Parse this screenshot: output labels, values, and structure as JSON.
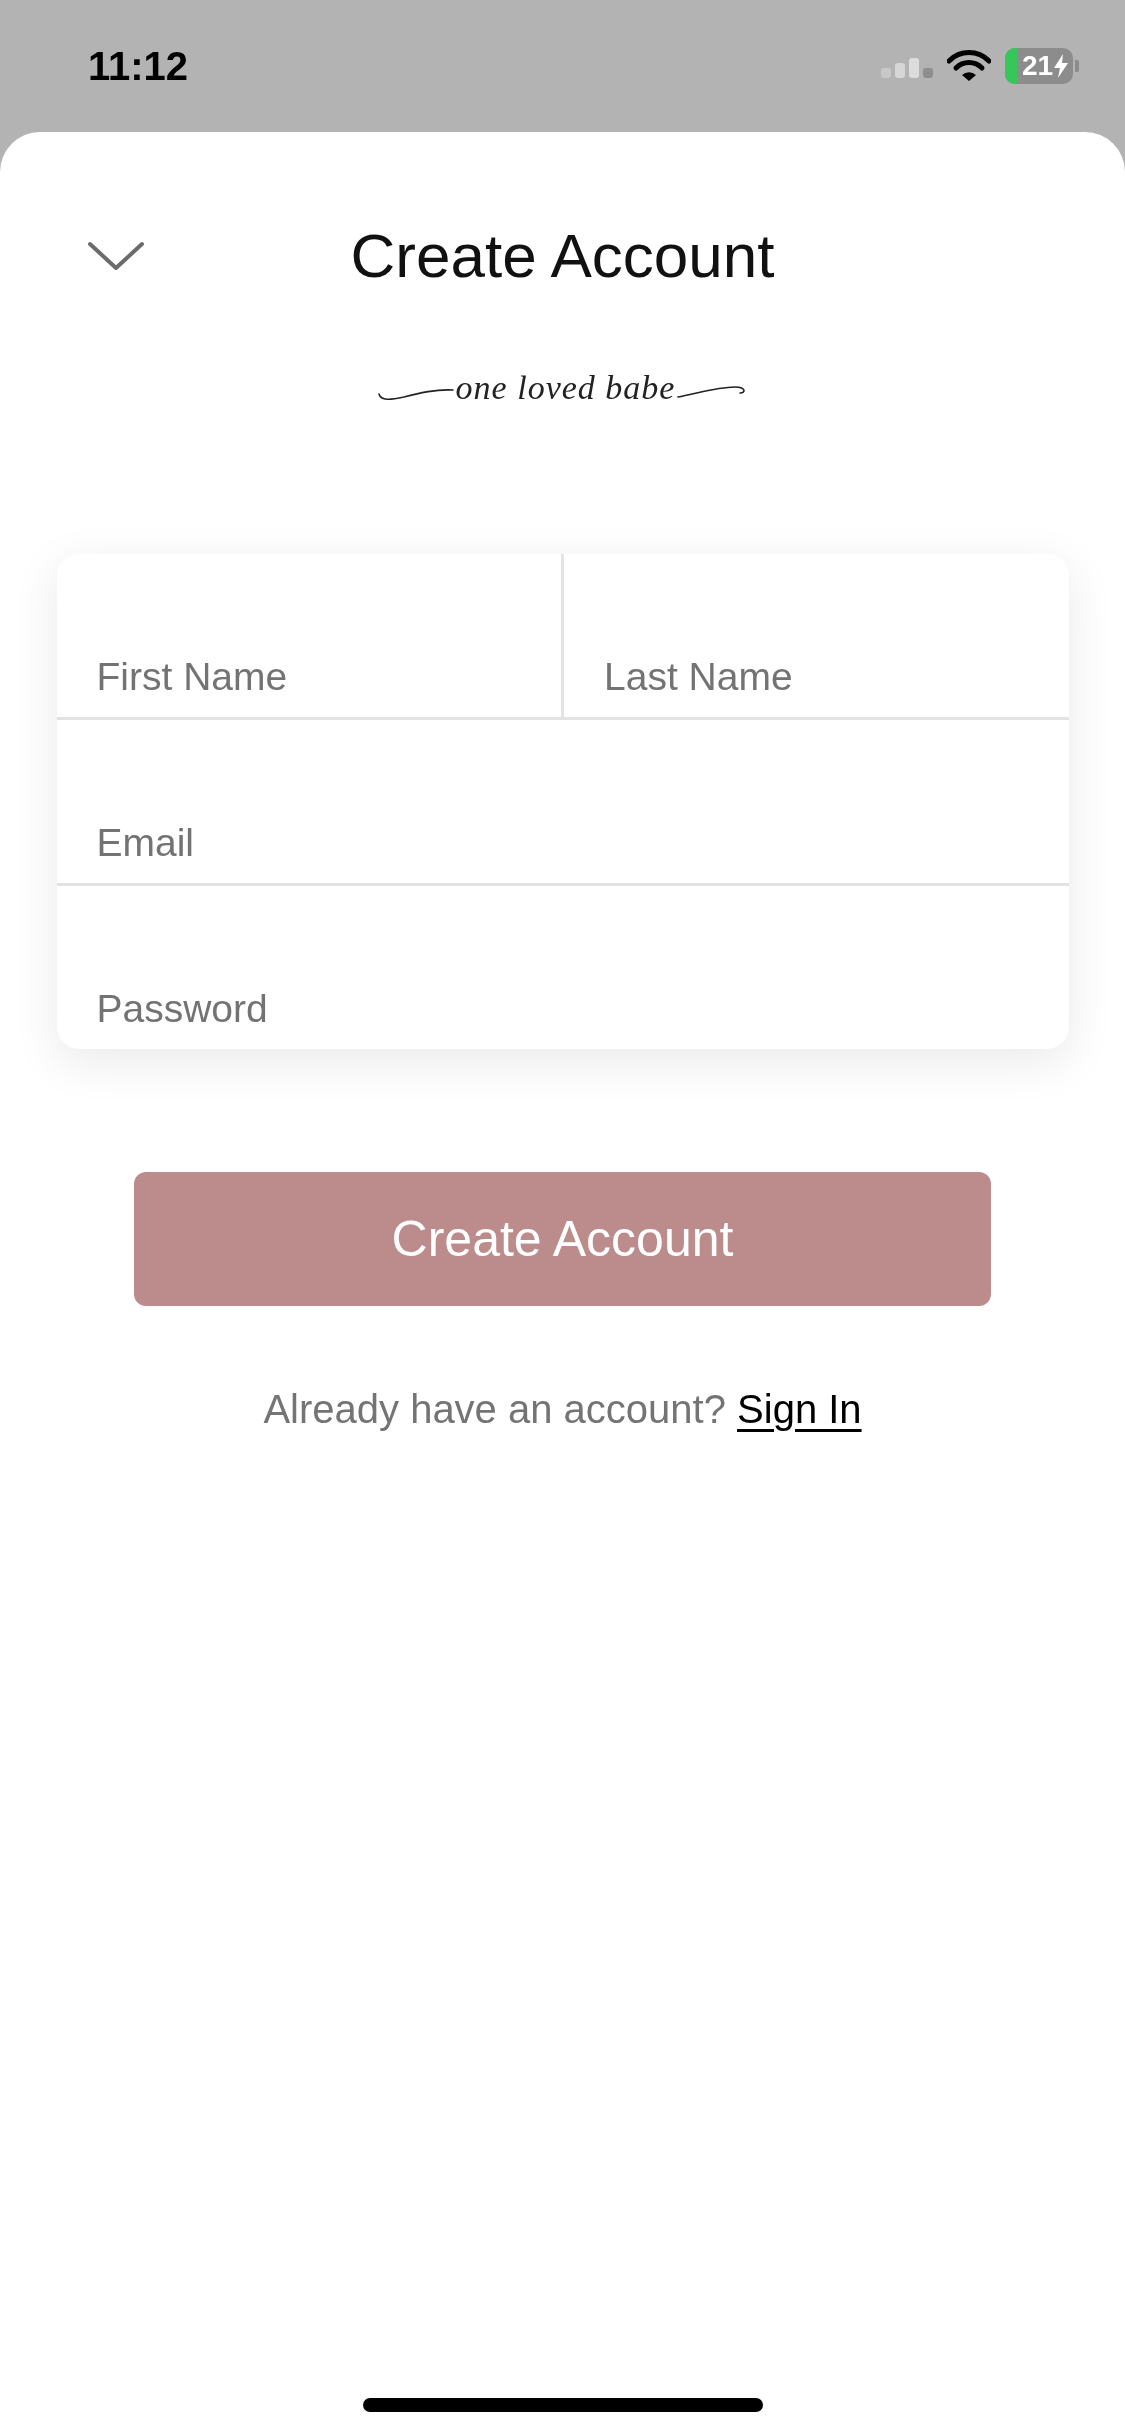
{
  "status_bar": {
    "time": "11:12",
    "battery": "21"
  },
  "header": {
    "title": "Create Account",
    "logo": "one loved babe"
  },
  "form": {
    "rows": [
      {
        "fields": [
          {
            "placeholder": "First Name"
          },
          {
            "placeholder": "Last Name"
          }
        ]
      },
      {
        "fields": [
          {
            "placeholder": "Email"
          }
        ]
      },
      {
        "fields": [
          {
            "placeholder": "Password"
          }
        ]
      }
    ]
  },
  "primary_button": {
    "label": "Create Account"
  },
  "footer": {
    "prompt": "Already have an account?",
    "link": "Sign In"
  }
}
